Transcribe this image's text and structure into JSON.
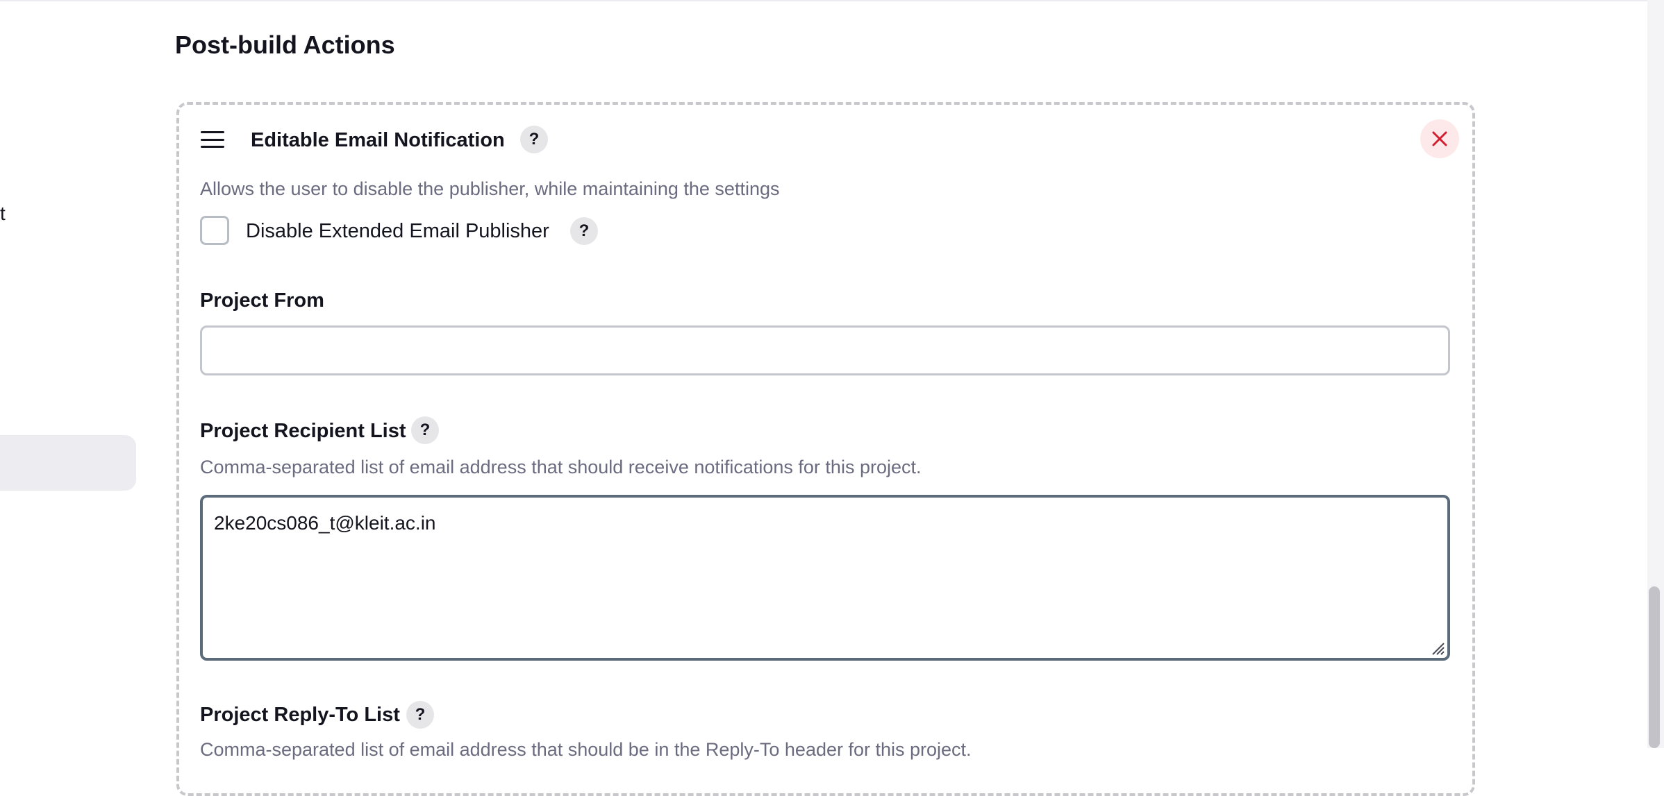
{
  "sidebar": {
    "fragment_text": "t"
  },
  "section": {
    "title": "Post-build Actions"
  },
  "card": {
    "title": "Editable Email Notification",
    "description": "Allows the user to disable the publisher, while maintaining the settings",
    "close_icon": "close-x-icon",
    "drag_icon": "drag-handle-icon"
  },
  "disable_publisher": {
    "label": "Disable Extended Email Publisher",
    "checked": false
  },
  "project_from": {
    "label": "Project From",
    "value": ""
  },
  "recipient_list": {
    "label": "Project Recipient List",
    "description": "Comma-separated list of email address that should receive notifications for this project.",
    "value": "2ke20cs086_t@kleit.ac.in"
  },
  "reply_to_list": {
    "label": "Project Reply-To List",
    "description": "Comma-separated list of email address that should be in the Reply-To header for this project."
  },
  "help": {
    "symbol": "?"
  },
  "colors": {
    "close_bg": "#fde8ea",
    "close_icon": "#d21f2f",
    "focus_border": "#5b6b7a",
    "muted_text": "#6b6b80"
  }
}
